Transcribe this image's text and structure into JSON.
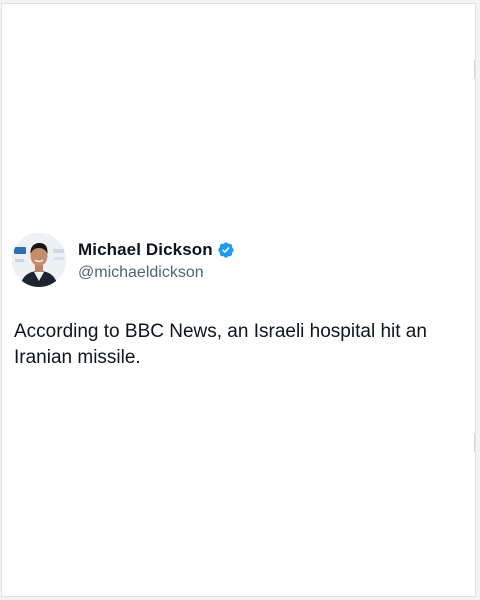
{
  "tweet": {
    "author": {
      "display_name": "Michael Dickson",
      "handle": "@michaeldickson",
      "verified": true,
      "avatar_icon": "profile-photo",
      "verified_icon": "verified-badge-icon",
      "verified_color": "#1d9bf0"
    },
    "text": "According to BBC News, an Israeli hospital hit an Iranian missile."
  },
  "colors": {
    "text_primary": "#0f1419",
    "text_secondary": "#536471",
    "background": "#ffffff"
  }
}
